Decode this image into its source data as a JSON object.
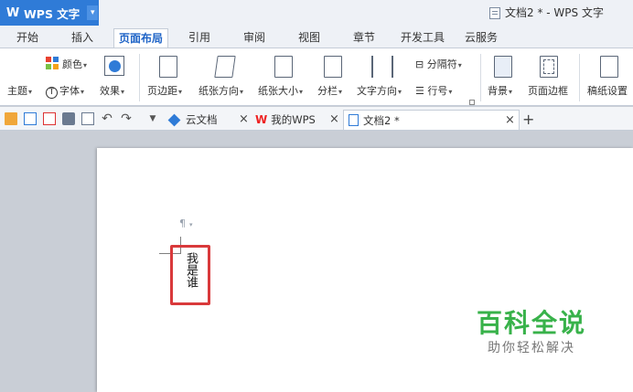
{
  "titlebar": {
    "app_logo": "W",
    "app_name": "WPS 文字",
    "app_menu_arrow": "▾",
    "document_title": "文档2 * - WPS 文字"
  },
  "menu_tabs": [
    "开始",
    "插入",
    "页面布局",
    "引用",
    "审阅",
    "视图",
    "章节",
    "开发工具",
    "云服务"
  ],
  "active_menu_tab": "页面布局",
  "ribbon": {
    "theme": "主题",
    "color": "颜色",
    "font": "字体",
    "effects": "效果",
    "margins": "页边距",
    "orientation": "纸张方向",
    "size": "纸张大小",
    "columns": "分栏",
    "text_direction": "文字方向",
    "breaks": "分隔符",
    "line_numbers": "行号",
    "background": "背景",
    "page_borders": "页面边框",
    "manuscript": "稿纸设置",
    "dropdown_caret": "▾"
  },
  "doc_tabs": [
    {
      "label": "云文档",
      "close": "×",
      "icon": "cloud-icon"
    },
    {
      "label": "我的WPS",
      "close": "×",
      "icon": "wps-logo-icon"
    },
    {
      "label": "文档2 *",
      "close": "×",
      "icon": "document-icon"
    }
  ],
  "new_tab": "+",
  "quick_access": {
    "undo": "↶",
    "redo": "↷",
    "more": "▼"
  },
  "document": {
    "paragraph_mark": "¶",
    "paragraph_caret": "▾",
    "vertical_text": "我是谁"
  },
  "watermark": {
    "title": "百科全说",
    "subtitle": "助你轻松解决"
  },
  "colors": {
    "accent": "#2f7bd7",
    "highlight_box": "#d9393b",
    "watermark_green": "#38b24a",
    "workspace": "#c9ced6"
  }
}
